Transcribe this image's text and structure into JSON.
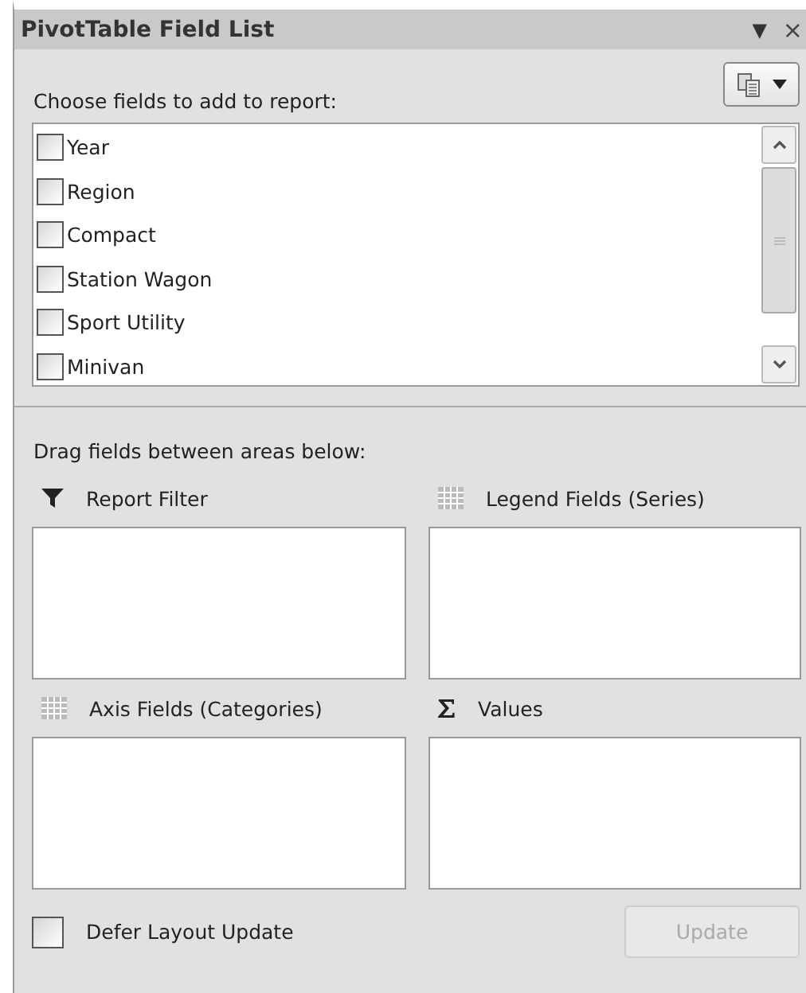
{
  "window": {
    "title": "PivotTable Field List",
    "menu_glyph": "▼",
    "close_glyph": "×"
  },
  "fields_prompt": "Choose fields to add to report:",
  "fields": [
    {
      "label": "Year",
      "checked": false
    },
    {
      "label": "Region",
      "checked": false
    },
    {
      "label": "Compact",
      "checked": false
    },
    {
      "label": "Station Wagon",
      "checked": false
    },
    {
      "label": "Sport Utility",
      "checked": false
    },
    {
      "label": "Minivan",
      "checked": false
    }
  ],
  "areas_prompt": "Drag fields between areas below:",
  "areas": [
    {
      "label": "Report Filter",
      "kind": "filter"
    },
    {
      "label": "Legend Fields (Series)",
      "kind": "grid"
    },
    {
      "label": "Axis Fields (Categories)",
      "kind": "grid"
    },
    {
      "label": "Values",
      "kind": "sigma"
    }
  ],
  "defer": {
    "label": "Defer Layout Update",
    "checked": false
  },
  "update_button": {
    "label": "Update",
    "disabled": true
  }
}
